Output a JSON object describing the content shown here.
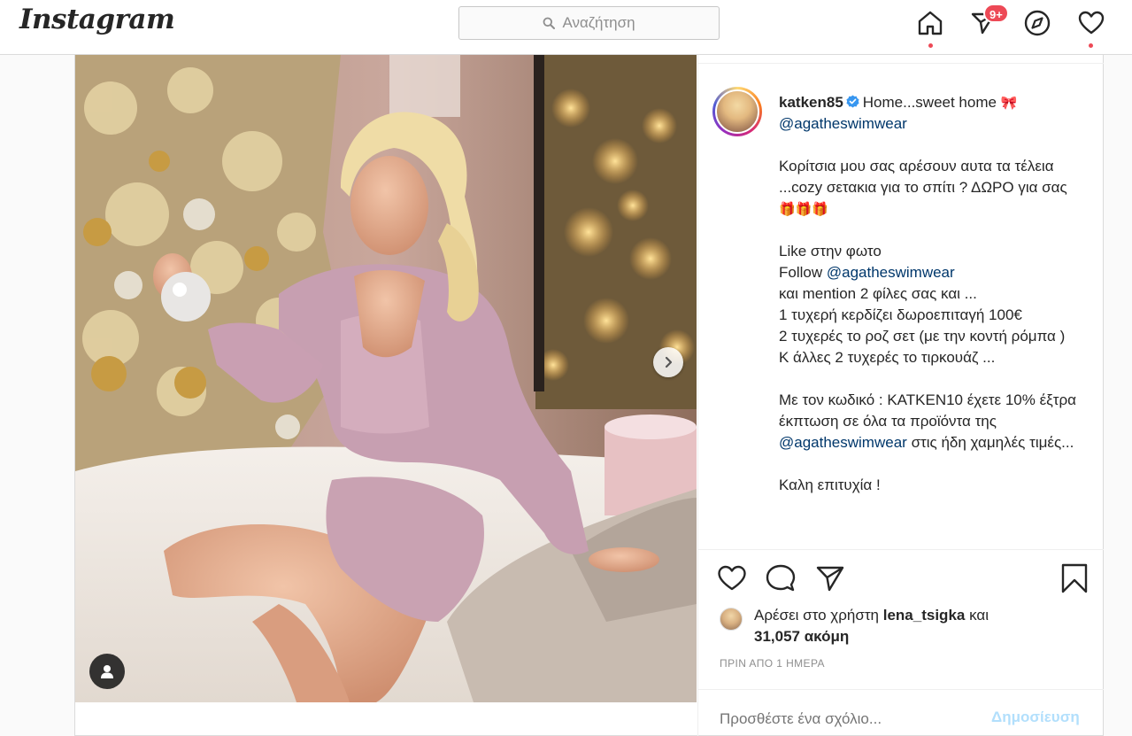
{
  "app": {
    "logo": "Instagram"
  },
  "search": {
    "placeholder": "Αναζήτηση"
  },
  "nav": {
    "items": [
      {
        "name": "home-icon",
        "active": true
      },
      {
        "name": "direct-icon",
        "badge": "9+"
      },
      {
        "name": "explore-icon"
      },
      {
        "name": "activity-icon",
        "has_dot": true
      }
    ]
  },
  "post": {
    "author": "katken85",
    "verified": true,
    "caption": {
      "line1_text": "Home...sweet home",
      "line1_emoji": "🎀",
      "mention1": "@agatheswimwear",
      "p2": "Κορίτσια μου σας αρέσουν αυτα τα τέλεια ...cozy σετακια για το σπίτι ? ΔΩΡΟ για σας",
      "gift_emojis": "🎁🎁🎁",
      "p3_like": "Like στην φωτο",
      "p3_follow": "Follow",
      "mention2": "@agatheswimwear",
      "p3_rest": "και mention 2 φίλες σας και ...\n1 τυχερή κερδίζει δωροεπιταγή 100€\n2 τυχερές το ροζ σετ (με την κοντή ρόμπα )\nΚ άλλες 2 τυχερές το τιρκουάζ ...",
      "p4_start": "Με τον κωδικό : KATKEN10 έχετε 10% έξτρα έκπτωση σε όλα τα προϊόντα της",
      "mention3": "@agatheswimwear",
      "p4_end": "στις ήδη χαμηλές τιμές...",
      "p5": "Καλη επιτυχία !"
    },
    "likes": {
      "prefix": "Αρέσει στο χρήστη",
      "user": "lena_tsigka",
      "middle": "και",
      "count": "31,057 ακόμη"
    },
    "timestamp": "ΠΡΙΝ ΑΠΟ 1 ΗΜΕΡΑ",
    "comment": {
      "placeholder": "Προσθέστε ένα σχόλιο...",
      "publish": "Δημοσίευση"
    }
  },
  "colors": {
    "notification": "#ed4956",
    "mention": "#00376b",
    "publish_disabled": "#b2dffc",
    "verified": "#3897f0"
  }
}
